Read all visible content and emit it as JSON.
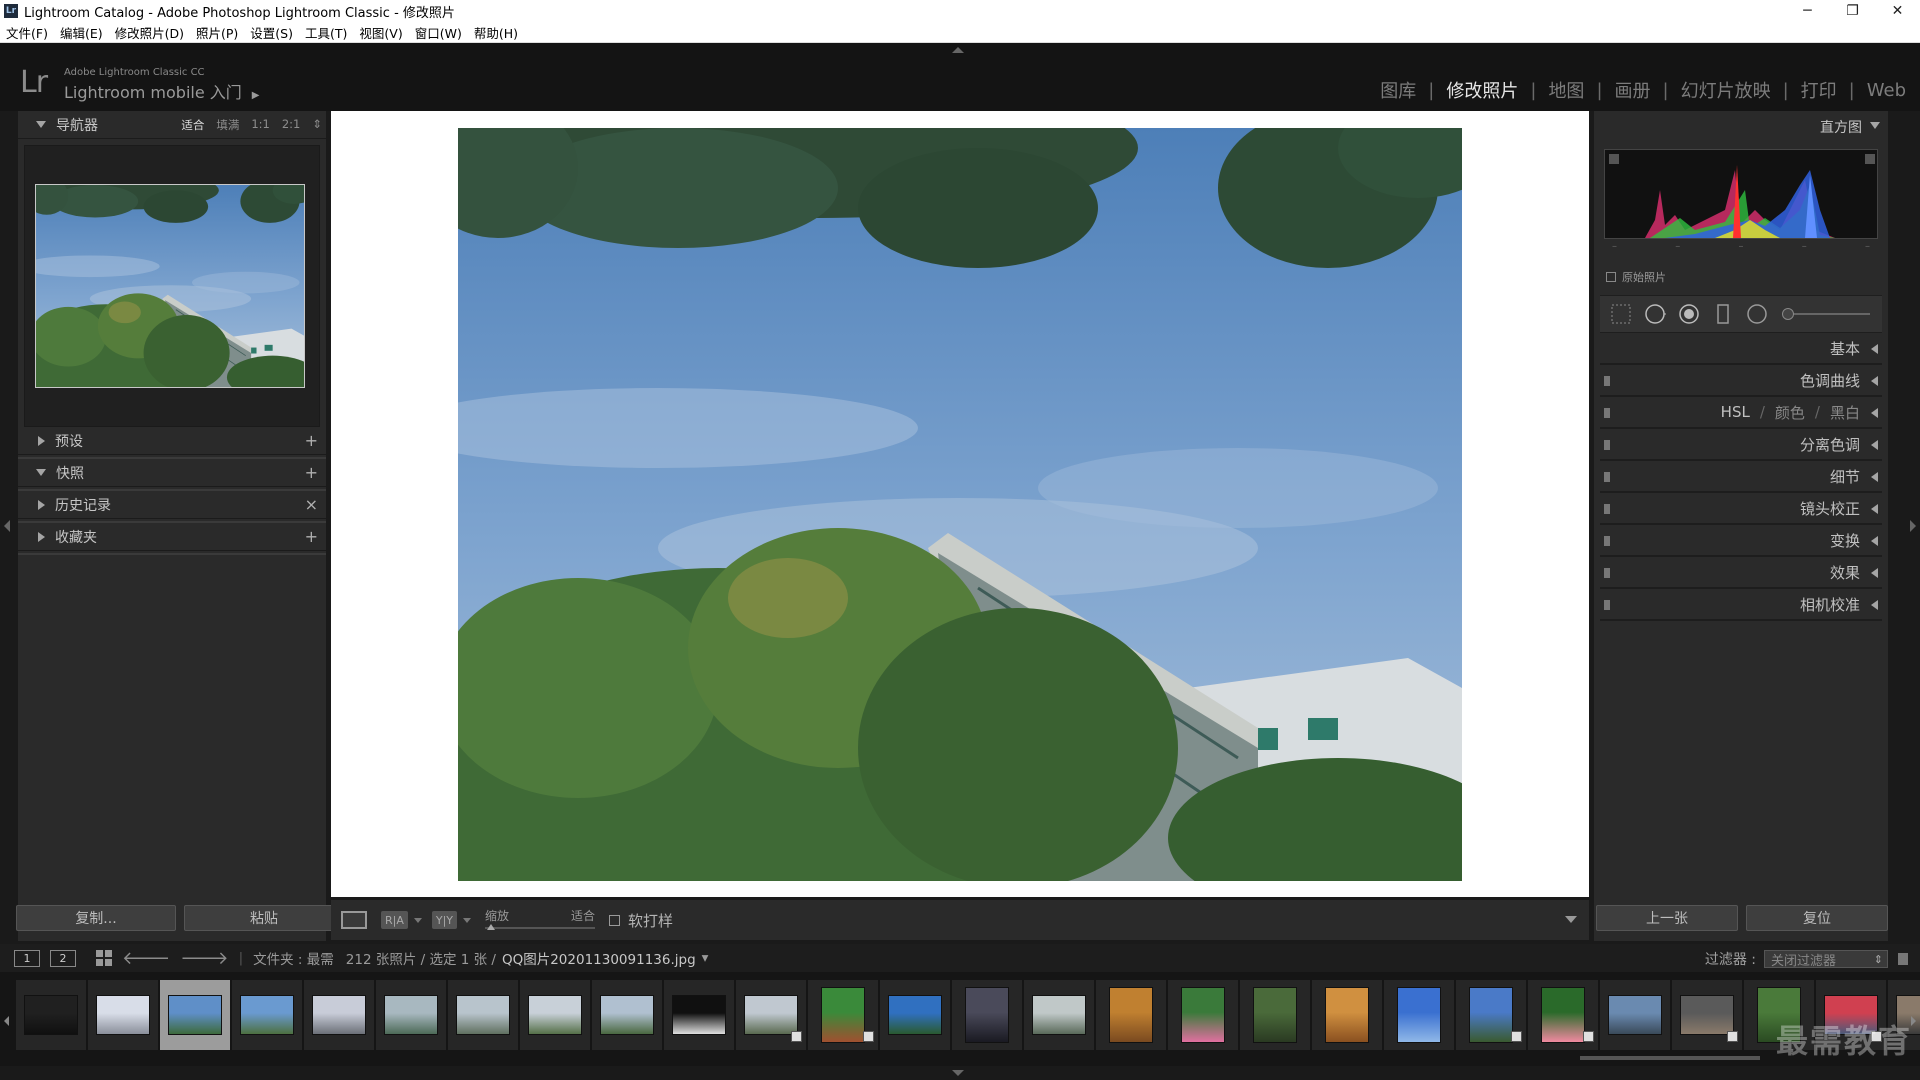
{
  "window": {
    "title": "Lightroom Catalog - Adobe Photoshop Lightroom Classic - 修改照片",
    "app_icon_text": "Lr",
    "minimize": "─",
    "restore": "❐",
    "close": "✕"
  },
  "menu": [
    "文件(F)",
    "编辑(E)",
    "修改照片(D)",
    "照片(P)",
    "设置(S)",
    "工具(T)",
    "视图(V)",
    "窗口(W)",
    "帮助(H)"
  ],
  "brand": {
    "logo": "Lr",
    "line1": "Adobe Lightroom Classic CC",
    "line2": "Lightroom mobile 入门",
    "arrow": "▶"
  },
  "modules": [
    {
      "label": "图库",
      "active": false
    },
    {
      "label": "修改照片",
      "active": true
    },
    {
      "label": "地图",
      "active": false
    },
    {
      "label": "画册",
      "active": false
    },
    {
      "label": "幻灯片放映",
      "active": false
    },
    {
      "label": "打印",
      "active": false
    },
    {
      "label": "Web",
      "active": false
    }
  ],
  "left_panel": {
    "navigator": {
      "title": "导航器",
      "zooms": [
        "适合",
        "填满",
        "1:1",
        "2:1"
      ],
      "selected_zoom": "适合",
      "zoom_stepper": "⇕"
    },
    "sections": [
      {
        "title": "预设",
        "action": "+",
        "expanded": false
      },
      {
        "title": "快照",
        "action": "+",
        "expanded": true
      },
      {
        "title": "历史记录",
        "action": "×",
        "expanded": false
      },
      {
        "title": "收藏夹",
        "action": "+",
        "expanded": false
      }
    ],
    "copy_button": "复制...",
    "paste_button": "粘贴"
  },
  "toolbar": {
    "view_icon_1": "R|A",
    "view_icon_2": "Y|Y",
    "zoom_label": "缩放",
    "zoom_value": "适合",
    "softproof_label": "软打样"
  },
  "right_panel": {
    "histogram_title": "直方图",
    "histogram_ticks": [
      "–",
      "–",
      "–",
      "–",
      "–"
    ],
    "original_photo_label": "原始照片",
    "sections": [
      {
        "title": "基本",
        "has_switch": false
      },
      {
        "title": "色调曲线",
        "has_switch": true
      },
      {
        "title": "HSL",
        "sub1": "颜色",
        "sub2": "黑白",
        "has_switch": true
      },
      {
        "title": "分离色调",
        "has_switch": true
      },
      {
        "title": "细节",
        "has_switch": true
      },
      {
        "title": "镜头校正",
        "has_switch": true
      },
      {
        "title": "变换",
        "has_switch": true
      },
      {
        "title": "效果",
        "has_switch": true
      },
      {
        "title": "相机校准",
        "has_switch": true
      }
    ],
    "prev_button": "上一张",
    "reset_button": "复位"
  },
  "filmbar": {
    "screen1": "1",
    "screen2": "2",
    "back_arrow": "🡐",
    "forward_arrow": "🡒",
    "source": "文件夹 : 最需",
    "count": "212 张照片 / 选定 1 张 /",
    "filename": "QQ图片20201130091136.jpg",
    "filename_caret": "▾",
    "filter_label": "过滤器 :",
    "filter_value": "关闭过滤器"
  },
  "filmstrip": {
    "thumbnails": [
      {
        "colors": [
          "#202020",
          "#101010"
        ],
        "badge": false
      },
      {
        "colors": [
          "#d8dde8",
          "#8a8f9a"
        ],
        "badge": false
      },
      {
        "colors": [
          "#5f8fc8",
          "#3d6a3c"
        ],
        "badge": false
      },
      {
        "colors": [
          "#6a9ad0",
          "#4d7040"
        ],
        "badge": false
      },
      {
        "colors": [
          "#c8ccd8",
          "#6c7078"
        ],
        "badge": false
      },
      {
        "colors": [
          "#a8b8c0",
          "#4d6a58"
        ],
        "badge": false
      },
      {
        "colors": [
          "#b8c4cc",
          "#607060"
        ],
        "badge": false
      },
      {
        "colors": [
          "#c8d0d8",
          "#557048"
        ],
        "badge": false
      },
      {
        "colors": [
          "#b0c0d0",
          "#4a6840"
        ],
        "badge": false
      },
      {
        "colors": [
          "#101010",
          "#e0e0e0"
        ],
        "badge": false
      },
      {
        "colors": [
          "#c0c8d0",
          "#5a6a50"
        ],
        "badge": true
      },
      {
        "colors": [
          "#3a8a3a",
          "#a05030"
        ],
        "badge": true
      },
      {
        "colors": [
          "#3070c0",
          "#2a5a30"
        ],
        "badge": false
      },
      {
        "colors": [
          "#4a4a5a",
          "#1a1a22"
        ],
        "badge": false
      },
      {
        "colors": [
          "#c0c8c8",
          "#5a6a5a"
        ],
        "badge": false
      },
      {
        "colors": [
          "#c08030",
          "#7a4a20"
        ],
        "badge": false
      },
      {
        "colors": [
          "#3a7a3a",
          "#e070a0"
        ],
        "badge": false
      },
      {
        "colors": [
          "#4a6a3a",
          "#2a3a22"
        ],
        "badge": false
      },
      {
        "colors": [
          "#d09040",
          "#8a5020"
        ],
        "badge": false
      },
      {
        "colors": [
          "#3a70d0",
          "#90b8e8"
        ],
        "badge": false
      },
      {
        "colors": [
          "#4a7ac8",
          "#3a5a30"
        ],
        "badge": true
      },
      {
        "colors": [
          "#2a6a2a",
          "#f08aa0"
        ],
        "badge": true
      },
      {
        "colors": [
          "#6a8ab0",
          "#3a4a5a"
        ],
        "badge": false
      },
      {
        "colors": [
          "#5a5a5a",
          "#8a7a6a"
        ],
        "badge": true
      },
      {
        "colors": [
          "#4a7a3a",
          "#2a4a22"
        ],
        "badge": false
      },
      {
        "colors": [
          "#d04050",
          "#4a5a7a"
        ],
        "badge": true
      },
      {
        "colors": [
          "#8a7a6a",
          "#3a3a3a"
        ],
        "badge": false
      }
    ],
    "selected_index": 2
  },
  "watermark": "最需教育"
}
